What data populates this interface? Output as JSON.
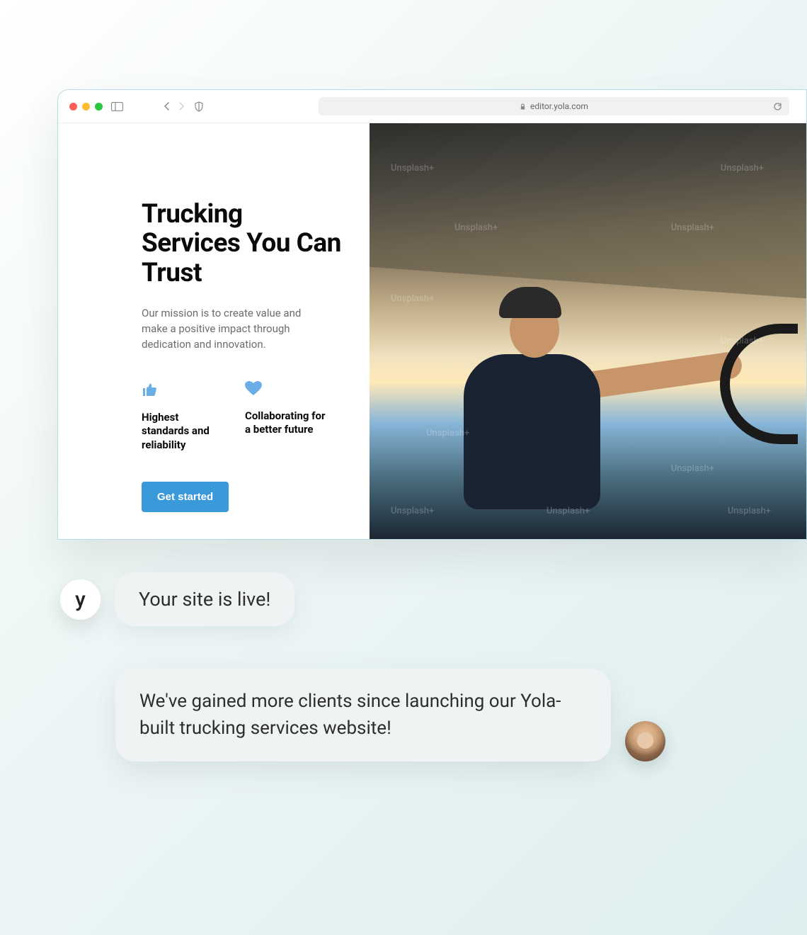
{
  "browser": {
    "url": "editor.yola.com"
  },
  "site": {
    "title": "Trucking Services You Can Trust",
    "subtitle": "Our mission is to create value and make a positive impact through dedication and innovation.",
    "features": [
      {
        "label": "Highest standards and reliability"
      },
      {
        "label": "Collaborating for a better future"
      }
    ],
    "cta_label": "Get started",
    "watermark": "Unsplash+"
  },
  "chat": {
    "avatar_letter": "y",
    "bubble1": "Your site is live!",
    "bubble2": "We've gained more clients since launching our Yola-built trucking services website!"
  }
}
